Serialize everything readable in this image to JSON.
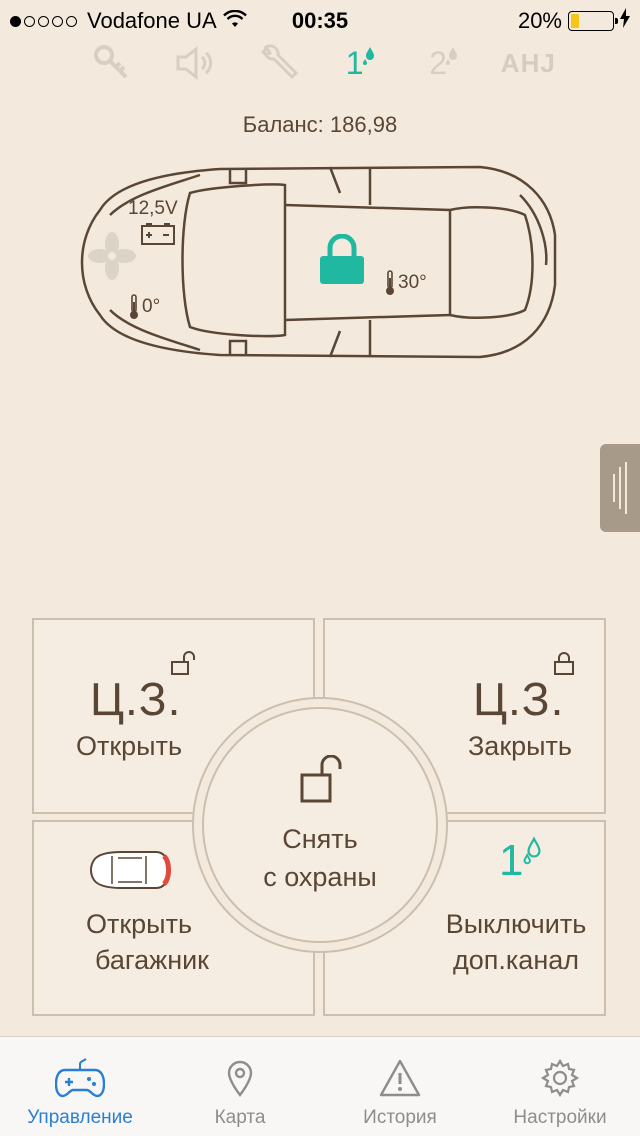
{
  "status": {
    "carrier": "Vodafone UA",
    "time": "00:35",
    "battery": "20%",
    "battery_level": 0.2
  },
  "top_icons": [
    {
      "icon": "key-icon"
    },
    {
      "icon": "speaker-icon"
    },
    {
      "icon": "wrench-icon"
    },
    {
      "icon": "channel-1-icon",
      "label": "1",
      "active": true
    },
    {
      "icon": "channel-2-icon",
      "label": "2"
    },
    {
      "icon": "ahj-icon",
      "label": "AHJ"
    }
  ],
  "balance": "Баланс: 186,98",
  "car": {
    "voltage": "12,5V",
    "battery_signs": "+ -",
    "temp_outside": "0°",
    "temp_inside": "30°"
  },
  "controls": {
    "lock_open": {
      "big": "Ц.З.",
      "label": "Открыть"
    },
    "lock_close": {
      "big": "Ц.З.",
      "label": "Закрыть"
    },
    "trunk": {
      "label_1": "Открыть",
      "label_2": "багажник"
    },
    "channel": {
      "number": "1",
      "label_1": "Выключить",
      "label_2": "доп.канал"
    },
    "disarm": {
      "label_1": "Снять",
      "label_2": "с охраны"
    }
  },
  "tabs": [
    {
      "label": "Управление",
      "icon": "gamepad-icon",
      "active": true
    },
    {
      "label": "Карта",
      "icon": "map-pin-icon"
    },
    {
      "label": "История",
      "icon": "warning-icon"
    },
    {
      "label": "Настройки",
      "icon": "gear-icon"
    }
  ],
  "colors": {
    "accent": "#21b8a2",
    "tab_active": "#2a7fd4",
    "background": "#f3eadd",
    "text": "#5a4634"
  }
}
